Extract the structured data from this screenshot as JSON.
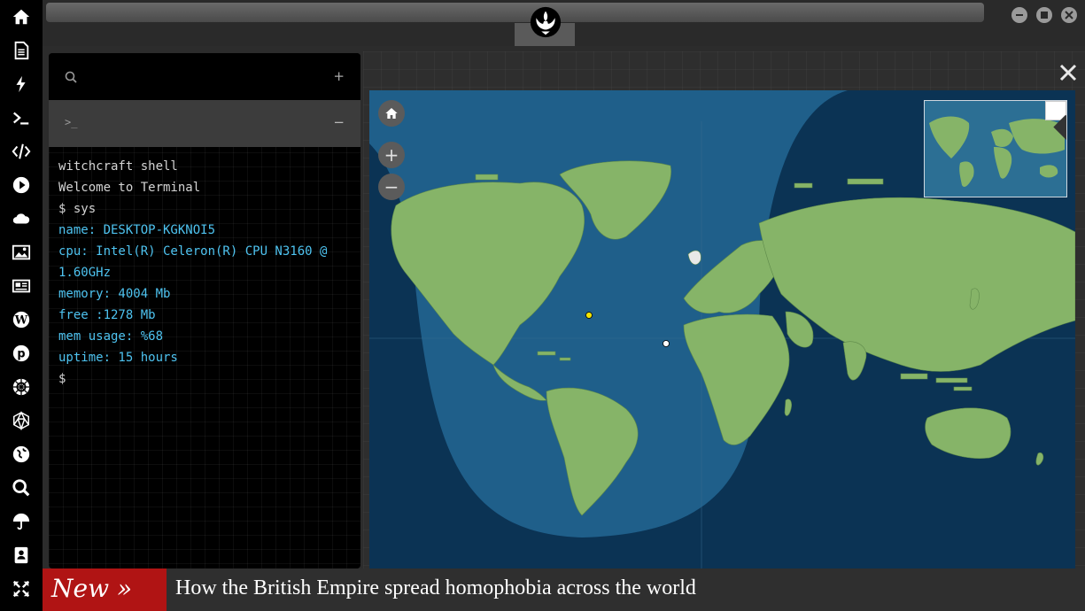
{
  "dock": {
    "items": [
      {
        "name": "home-icon"
      },
      {
        "name": "document-icon"
      },
      {
        "name": "bolt-icon"
      },
      {
        "name": "terminal-icon"
      },
      {
        "name": "code-icon"
      },
      {
        "name": "play-icon"
      },
      {
        "name": "cloud-icon"
      },
      {
        "name": "image-icon"
      },
      {
        "name": "newspaper-icon"
      },
      {
        "name": "wordpress-icon"
      },
      {
        "name": "pinterest-icon"
      },
      {
        "name": "galactic-empire-icon"
      },
      {
        "name": "geodesic-icon"
      },
      {
        "name": "globe-icon"
      },
      {
        "name": "search-icon"
      },
      {
        "name": "umbrella-icon"
      },
      {
        "name": "contact-card-icon"
      },
      {
        "name": "expand-icon"
      }
    ]
  },
  "titlebar": {
    "logo": "rebel-alliance-logo",
    "controls": [
      "minimize",
      "maximize",
      "close"
    ]
  },
  "terminal": {
    "search_icon": "search-icon",
    "add_label": "+",
    "tab_prompt": ">_",
    "collapse_label": "−",
    "lines": [
      {
        "text": "witchcraft shell",
        "style": "plain"
      },
      {
        "text": "Welcome to Terminal",
        "style": "plain"
      },
      {
        "text": "$ sys",
        "style": "plain"
      },
      {
        "text": "name: DESKTOP-KGKNOI5",
        "style": "cyan"
      },
      {
        "text": "cpu: Intel(R) Celeron(R) CPU N3160 @ 1.60GHz",
        "style": "cyan"
      },
      {
        "text": "memory: 4004 Mb",
        "style": "cyan"
      },
      {
        "text": "free :1278 Mb",
        "style": "cyan"
      },
      {
        "text": "mem usage: %68",
        "style": "cyan"
      },
      {
        "text": "uptime: 15 hours",
        "style": "cyan"
      },
      {
        "text": "$",
        "style": "plain"
      }
    ]
  },
  "map": {
    "ocean_color": "#0b3354",
    "day_color": "#1f5f8a",
    "land_color": "#86b468",
    "home_icon": "home-icon",
    "zoom_in_label": "+",
    "zoom_out_label": "−",
    "overview_toggle_icon": "chevron-down-icon",
    "close_icon": "close-icon"
  },
  "ticker": {
    "label": "New »",
    "headline": "How the British Empire spread homophobia across the world",
    "label_color": "#b01414"
  }
}
